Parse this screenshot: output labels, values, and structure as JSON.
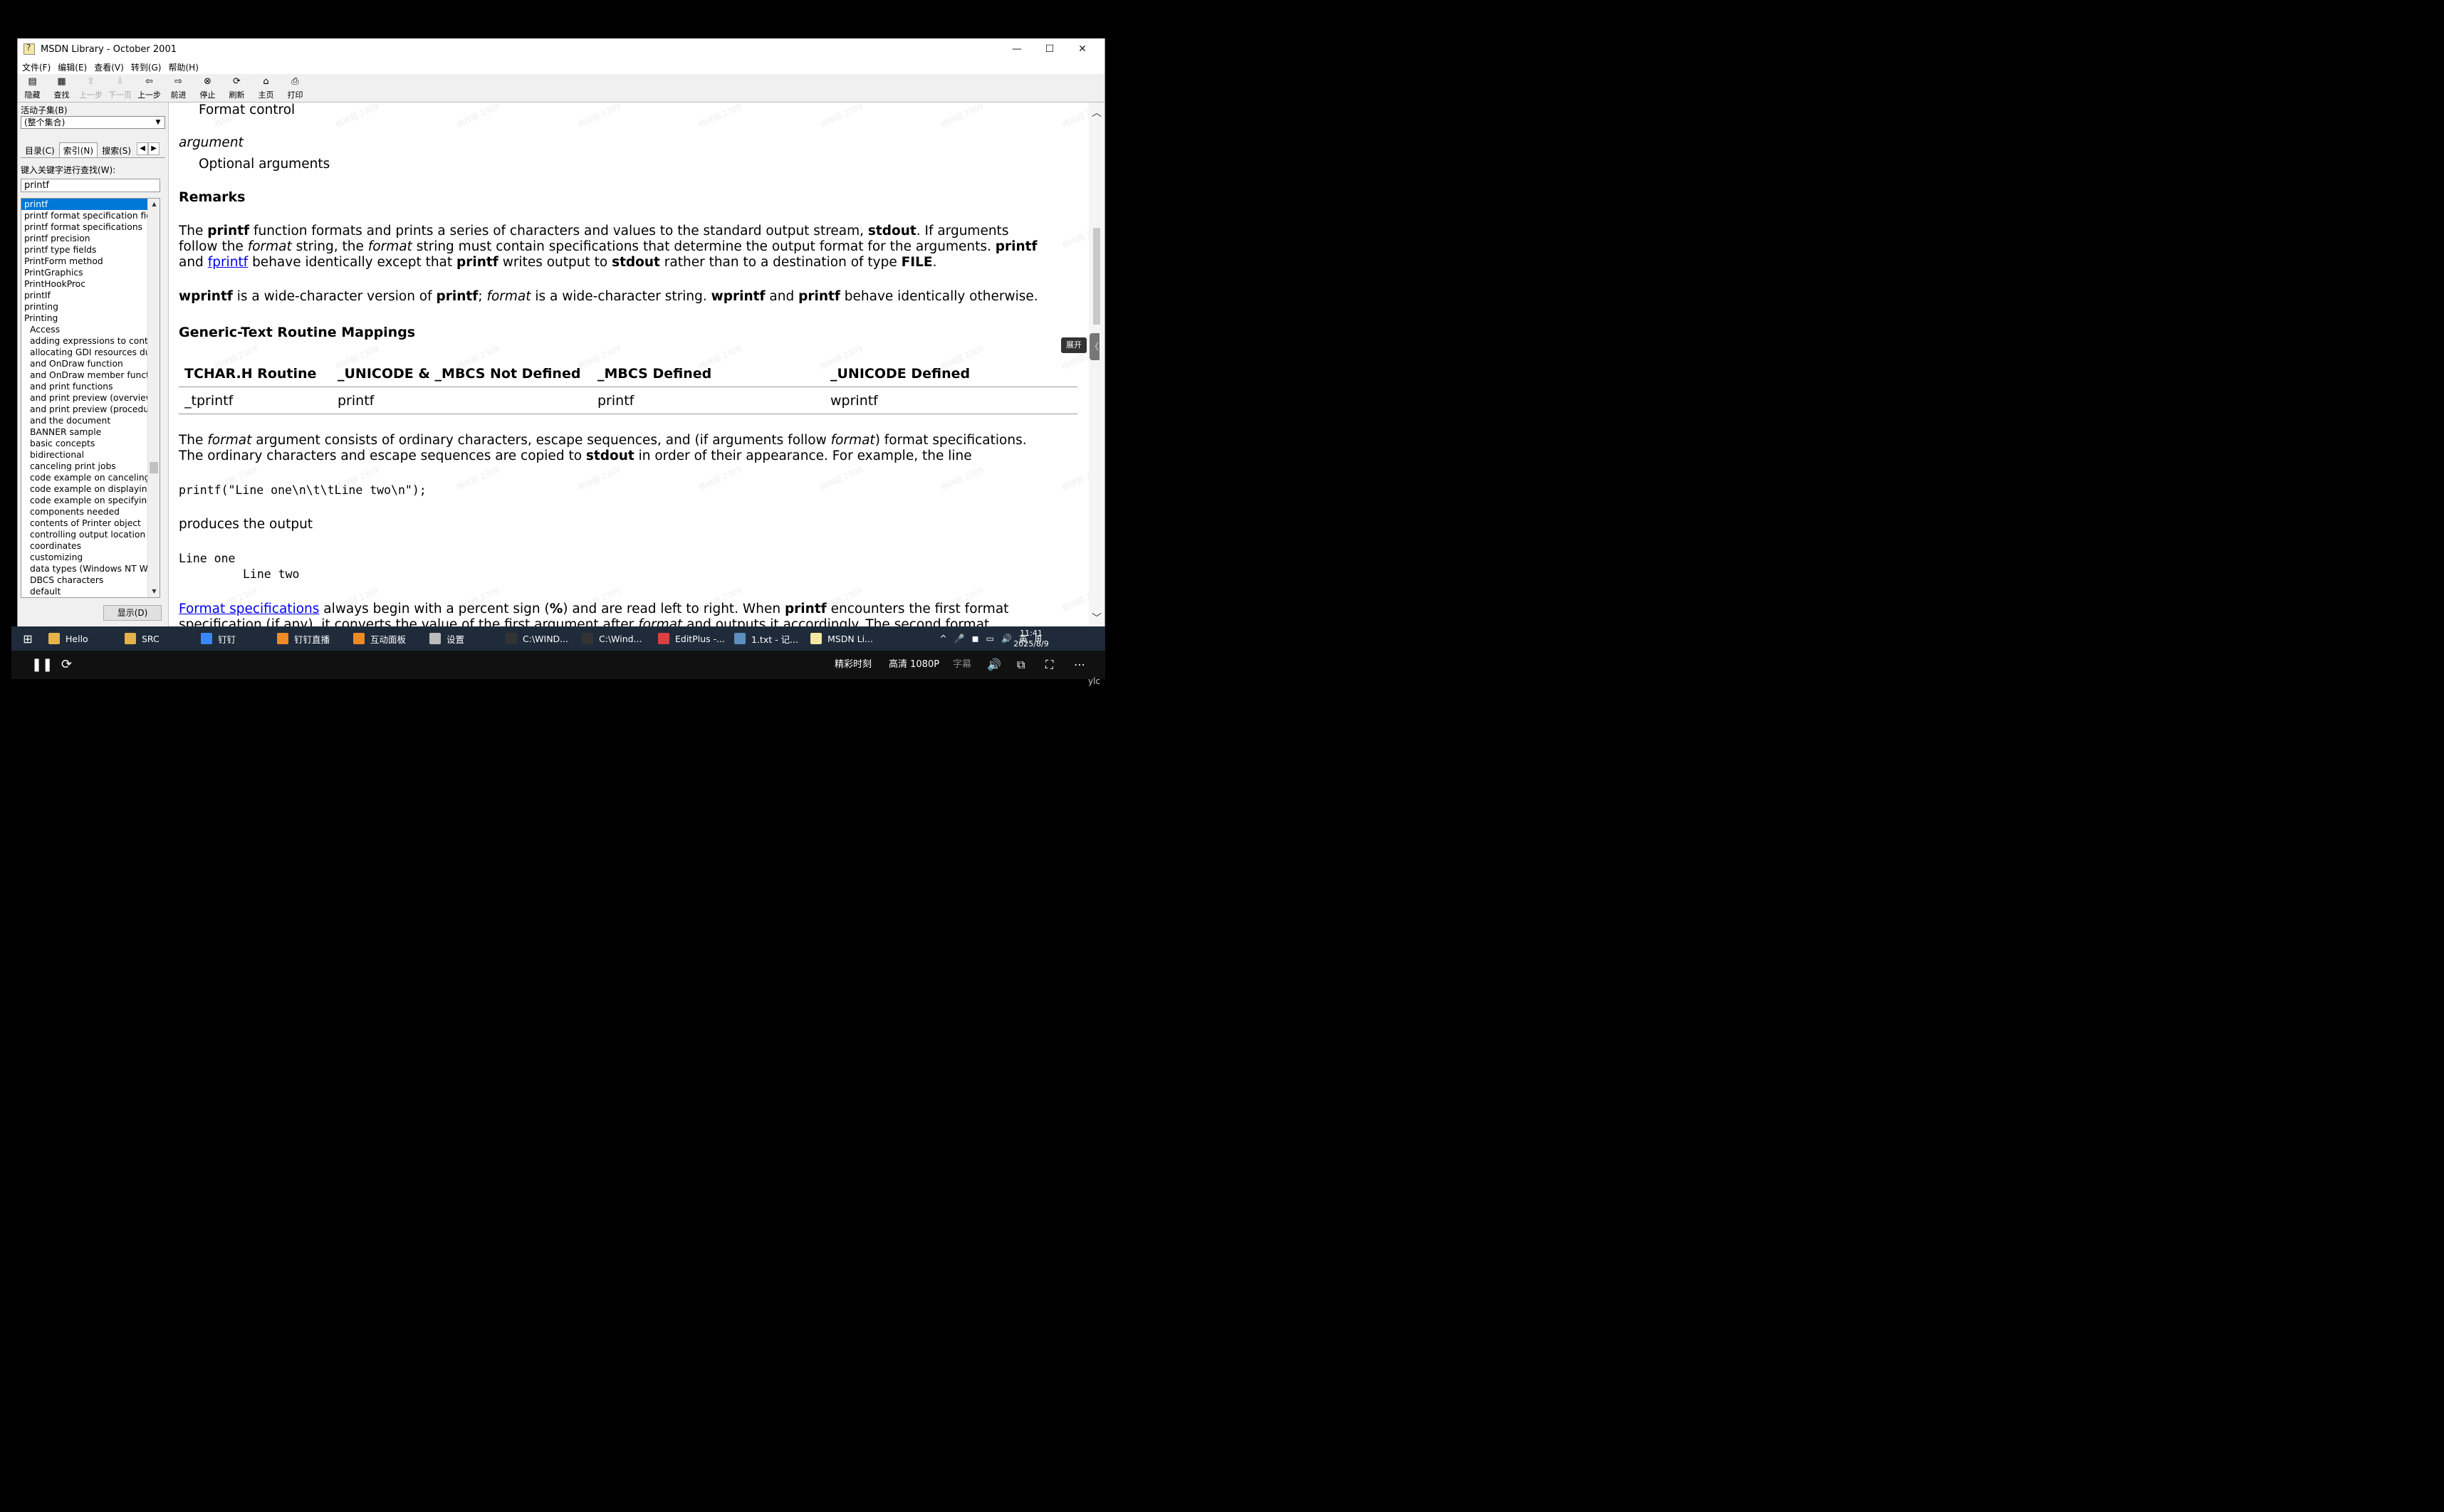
{
  "window": {
    "title": "MSDN Library - October 2001",
    "controls": [
      "—",
      "☐",
      "✕"
    ]
  },
  "menu": [
    "文件(F)",
    "编辑(E)",
    "查看(V)",
    "转到(G)",
    "帮助(H)"
  ],
  "toolbar": [
    {
      "label": "隐藏",
      "icon": "hide-icon",
      "glyph": "▤",
      "enabled": true
    },
    {
      "label": "查找",
      "icon": "find-icon",
      "glyph": "▦",
      "enabled": true
    },
    {
      "label": "上一步",
      "icon": "up-arrow-icon",
      "glyph": "⇧",
      "enabled": false
    },
    {
      "label": "下一页",
      "icon": "down-arrow-icon",
      "glyph": "⇩",
      "enabled": false
    },
    {
      "label": "上一步",
      "icon": "back-arrow-icon",
      "glyph": "⇦",
      "enabled": true
    },
    {
      "label": "前进",
      "icon": "forward-arrow-icon",
      "glyph": "⇨",
      "enabled": true
    },
    {
      "label": "停止",
      "icon": "stop-icon",
      "glyph": "⊗",
      "enabled": true
    },
    {
      "label": "刷新",
      "icon": "refresh-icon",
      "glyph": "⟳",
      "enabled": true
    },
    {
      "label": "主页",
      "icon": "home-icon",
      "glyph": "⌂",
      "enabled": true
    },
    {
      "label": "打印",
      "icon": "print-icon",
      "glyph": "⎙",
      "enabled": true
    }
  ],
  "sidebar": {
    "subset_label": "活动子集(B)",
    "subset_value": "(整个集合)",
    "tabs": [
      "目录(C)",
      "索引(N)",
      "搜索(S)"
    ],
    "keyword_label": "键入关键字进行查找(W):",
    "keyword_value": "printf",
    "index_items": [
      {
        "text": "printf",
        "sub": false,
        "selected": true
      },
      {
        "text": "printf format specification fiel",
        "sub": false,
        "selected": false
      },
      {
        "text": "printf format specifications",
        "sub": false,
        "selected": false
      },
      {
        "text": "printf precision",
        "sub": false,
        "selected": false
      },
      {
        "text": "printf type fields",
        "sub": false,
        "selected": false
      },
      {
        "text": "PrintForm method",
        "sub": false,
        "selected": false
      },
      {
        "text": "PrintGraphics",
        "sub": false,
        "selected": false
      },
      {
        "text": "PrintHookProc",
        "sub": false,
        "selected": false
      },
      {
        "text": "printIf",
        "sub": false,
        "selected": false
      },
      {
        "text": "printing",
        "sub": false,
        "selected": false
      },
      {
        "text": "Printing",
        "sub": false,
        "selected": false
      },
      {
        "text": "Access",
        "sub": true,
        "selected": false
      },
      {
        "text": "adding expressions to contr",
        "sub": true,
        "selected": false
      },
      {
        "text": "allocating GDI resources dur",
        "sub": true,
        "selected": false
      },
      {
        "text": "and OnDraw function",
        "sub": true,
        "selected": false
      },
      {
        "text": "and OnDraw member functic",
        "sub": true,
        "selected": false
      },
      {
        "text": "and print functions",
        "sub": true,
        "selected": false
      },
      {
        "text": "and print preview (overview)",
        "sub": true,
        "selected": false
      },
      {
        "text": "and print preview (procedur",
        "sub": true,
        "selected": false
      },
      {
        "text": "and the document",
        "sub": true,
        "selected": false
      },
      {
        "text": "BANNER sample",
        "sub": true,
        "selected": false
      },
      {
        "text": "basic concepts",
        "sub": true,
        "selected": false
      },
      {
        "text": "bidirectional",
        "sub": true,
        "selected": false
      },
      {
        "text": "canceling print jobs",
        "sub": true,
        "selected": false
      },
      {
        "text": "code example on canceling p",
        "sub": true,
        "selected": false
      },
      {
        "text": "code example on displaying",
        "sub": true,
        "selected": false
      },
      {
        "text": "code example on specifying",
        "sub": true,
        "selected": false
      },
      {
        "text": "components needed",
        "sub": true,
        "selected": false
      },
      {
        "text": "contents of Printer object",
        "sub": true,
        "selected": false
      },
      {
        "text": "controlling output location",
        "sub": true,
        "selected": false
      },
      {
        "text": "coordinates",
        "sub": true,
        "selected": false
      },
      {
        "text": "customizing",
        "sub": true,
        "selected": false
      },
      {
        "text": "data types (Windows NT Wo",
        "sub": true,
        "selected": false
      },
      {
        "text": "DBCS characters",
        "sub": true,
        "selected": false
      },
      {
        "text": "default",
        "sub": true,
        "selected": false
      }
    ],
    "show_button": "显示(D)"
  },
  "content": {
    "format_control": "Format control",
    "argument_term": "argument",
    "argument_desc": "Optional arguments",
    "remarks_heading": "Remarks",
    "remarks_p1": [
      [
        {
          "t": "The "
        },
        {
          "t": "printf",
          "b": true
        },
        {
          "t": " function formats and prints a series of characters and values to the standard output stream, "
        },
        {
          "t": "stdout",
          "b": true
        },
        {
          "t": ". If arguments"
        }
      ],
      [
        {
          "t": "follow the "
        },
        {
          "t": "format",
          "i": true
        },
        {
          "t": " string, the "
        },
        {
          "t": "format",
          "i": true
        },
        {
          "t": " string must contain specifications that determine the output format for the arguments. "
        },
        {
          "t": "printf",
          "b": true
        }
      ],
      [
        {
          "t": "and "
        },
        {
          "t": "fprintf",
          "a": true
        },
        {
          "t": " behave identically except that "
        },
        {
          "t": "printf",
          "b": true
        },
        {
          "t": " writes output to "
        },
        {
          "t": "stdout",
          "b": true
        },
        {
          "t": " rather than to a destination of type "
        },
        {
          "t": "FILE",
          "b": true
        },
        {
          "t": "."
        }
      ]
    ],
    "remarks_p2": [
      [
        {
          "t": "wprintf",
          "b": true
        },
        {
          "t": " is a wide-character version of "
        },
        {
          "t": "printf",
          "b": true
        },
        {
          "t": "; "
        },
        {
          "t": "format",
          "i": true
        },
        {
          "t": " is a wide-character string. "
        },
        {
          "t": "wprintf",
          "b": true
        },
        {
          "t": " and "
        },
        {
          "t": "printf",
          "b": true
        },
        {
          "t": " behave identically otherwise."
        }
      ]
    ],
    "mapping_heading": "Generic-Text Routine Mappings",
    "mapping_table": {
      "headers": [
        "TCHAR.H Routine",
        "_UNICODE & _MBCS Not Defined",
        "_MBCS Defined",
        "_UNICODE Defined"
      ],
      "rows": [
        [
          "_tprintf",
          "printf",
          "printf",
          "wprintf"
        ]
      ]
    },
    "format_p": [
      [
        {
          "t": "The "
        },
        {
          "t": "format",
          "i": true
        },
        {
          "t": " argument consists of ordinary characters, escape sequences, and (if arguments follow "
        },
        {
          "t": "format",
          "i": true
        },
        {
          "t": ") format specifications."
        }
      ],
      [
        {
          "t": "The ordinary characters and escape sequences are copied to "
        },
        {
          "t": "stdout",
          "b": true
        },
        {
          "t": " in order of their appearance. For example, the line"
        }
      ]
    ],
    "code_line": "printf(\"Line one\\n\\t\\tLine two\\n\");",
    "produces": "produces the output",
    "output_line1": "Line one",
    "output_line2": "Line two",
    "spec_p": [
      [
        {
          "t": "Format specifications",
          "a": true
        },
        {
          "t": " always begin with a percent sign ("
        },
        {
          "t": "%",
          "b": true
        },
        {
          "t": ") and are read left to right. When "
        },
        {
          "t": "printf",
          "b": true
        },
        {
          "t": " encounters the first format"
        }
      ],
      [
        {
          "t": "specification (if any), it converts the value of the first argument after "
        },
        {
          "t": "format",
          "i": true
        },
        {
          "t": " and outputs it accordingly. The second format"
        }
      ]
    ],
    "watermark": "杨祥超 2309"
  },
  "expand_tag": "展开",
  "taskbar": {
    "items": [
      {
        "label": "Hello",
        "color": "#e6b34a"
      },
      {
        "label": "SRC",
        "color": "#e6b34a"
      },
      {
        "label": "钉钉",
        "color": "#3a86ff"
      },
      {
        "label": "钉钉直播",
        "color": "#f08a24"
      },
      {
        "label": "互动面板",
        "color": "#f08a24"
      },
      {
        "label": "设置",
        "color": "#bbbbbb"
      },
      {
        "label": "C:\\WIND...",
        "color": "#333333"
      },
      {
        "label": "C:\\Wind...",
        "color": "#333333"
      },
      {
        "label": "EditPlus -...",
        "color": "#d94040"
      },
      {
        "label": "1.txt - 记...",
        "color": "#5a8fbf"
      },
      {
        "label": "MSDN Li...",
        "color": "#f4e7a1"
      }
    ],
    "tray": [
      "^",
      "🎤",
      "◼",
      "▭",
      "🔊",
      "英",
      "⊞"
    ],
    "time": "11:41",
    "date": "2025/8/9"
  },
  "player": {
    "quality_label": "精彩时刻",
    "resolution": "高清 1080P",
    "subtitle": "字幕",
    "user": "ylc"
  }
}
